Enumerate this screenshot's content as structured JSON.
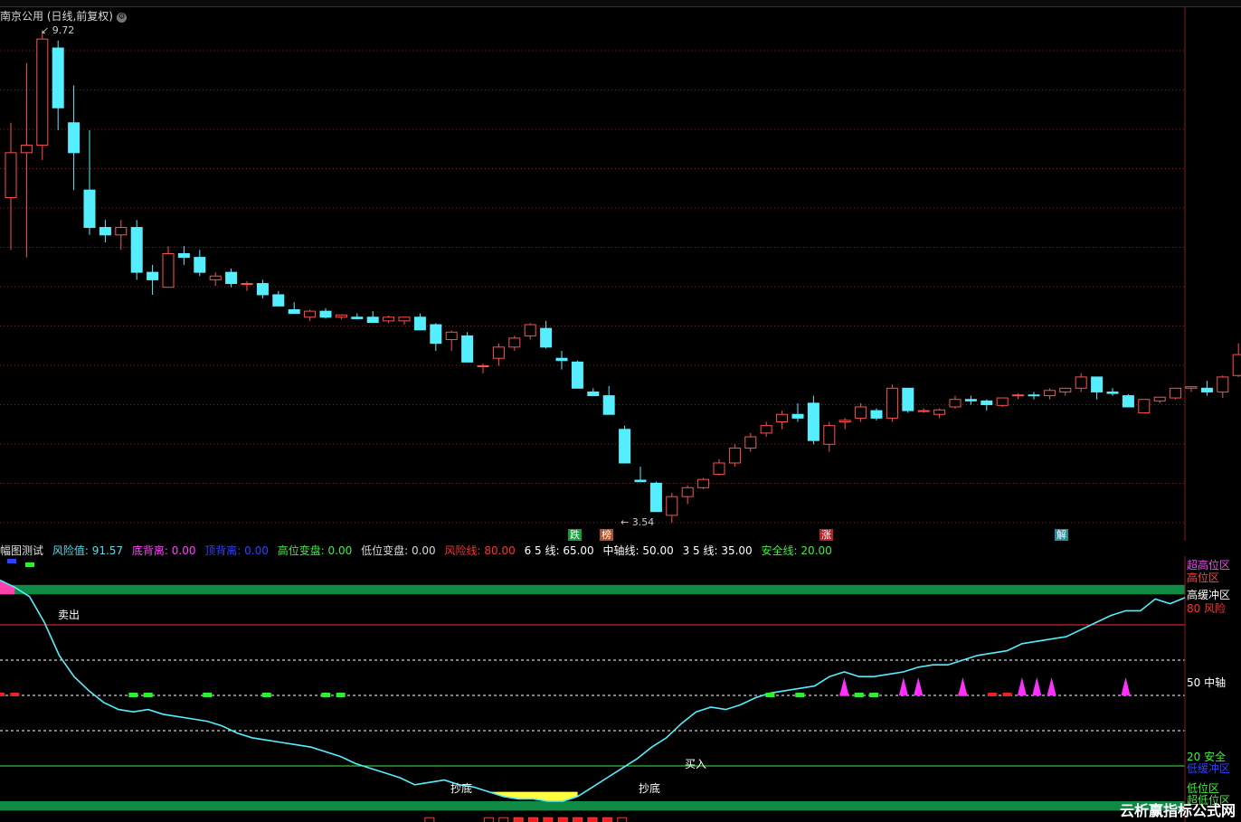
{
  "main": {
    "title": "南京公用 (日线,前复权)",
    "high_label": "9.72",
    "low_label": "3.54"
  },
  "markers": [
    {
      "text": "跌",
      "color": "#1a9a3a"
    },
    {
      "text": "榜",
      "color": "#b0502a"
    },
    {
      "text": "涨",
      "color": "#b8202a"
    },
    {
      "text": "解",
      "color": "#2a8a9a"
    }
  ],
  "indicator": {
    "name": "幅图测试",
    "items": [
      {
        "label": "风险值: 91.57",
        "color": "#55ddee"
      },
      {
        "label": "底背离: 0.00",
        "color": "#ff40ff"
      },
      {
        "label": "顶背离: 0.00",
        "color": "#3040ff"
      },
      {
        "label": "高位变盘: 0.00",
        "color": "#40ee40"
      },
      {
        "label": "低位变盘: 0.00",
        "color": "#d8d8d8"
      },
      {
        "label": "风险线: 80.00",
        "color": "#ff3030"
      },
      {
        "label": "6 5 线: 65.00",
        "color": "#ffffff"
      },
      {
        "label": "中轴线: 50.00",
        "color": "#ffffff"
      },
      {
        "label": "3 5 线: 35.00",
        "color": "#ffffff"
      },
      {
        "label": "安全线: 20.00",
        "color": "#40ee40"
      }
    ]
  },
  "zones": [
    {
      "text": "超高位区",
      "color": "#ff40ff"
    },
    {
      "text": "高位区",
      "color": "#ff4040"
    },
    {
      "text": "高缓冲区",
      "color": "#ffffff"
    },
    {
      "text": "80 风险",
      "color": "#ff3030"
    },
    {
      "text": "50 中轴",
      "color": "#ffffff"
    },
    {
      "text": "20 安全",
      "color": "#40ee40"
    },
    {
      "text": "低缓冲区",
      "color": "#3040ff"
    },
    {
      "text": "低位区",
      "color": "#40ee40"
    },
    {
      "text": "超低位区",
      "color": "#40ee40"
    }
  ],
  "annotations": {
    "sell": "卖出",
    "buy": "买入",
    "bottom1": "抄底",
    "bottom2": "抄底"
  },
  "watermark": "云析赢指标公式网",
  "colors": {
    "up": "#ff5050",
    "down": "#55eeff",
    "grid": "#8a1a1a"
  },
  "chart_data": [
    {
      "type": "candlestick",
      "title": "南京公用 (日线,前复权)",
      "high": 9.72,
      "low": 3.54,
      "ylim": [
        3.3,
        10.0
      ],
      "candles": [
        [
          7.6,
          8.6,
          6.9,
          8.2
        ],
        [
          8.2,
          9.4,
          6.8,
          8.3
        ],
        [
          8.3,
          9.8,
          8.1,
          9.72
        ],
        [
          9.6,
          9.7,
          8.5,
          8.8
        ],
        [
          8.6,
          9.1,
          7.7,
          8.2
        ],
        [
          7.7,
          8.5,
          7.1,
          7.2
        ],
        [
          7.2,
          7.3,
          7.0,
          7.1
        ],
        [
          7.1,
          7.3,
          6.9,
          7.2
        ],
        [
          7.2,
          7.3,
          6.5,
          6.6
        ],
        [
          6.6,
          6.7,
          6.3,
          6.5
        ],
        [
          6.4,
          6.95,
          6.4,
          6.85
        ],
        [
          6.85,
          6.95,
          6.7,
          6.8
        ],
        [
          6.8,
          6.9,
          6.55,
          6.6
        ],
        [
          6.5,
          6.6,
          6.42,
          6.55
        ],
        [
          6.6,
          6.65,
          6.4,
          6.45
        ],
        [
          6.45,
          6.48,
          6.35,
          6.45
        ],
        [
          6.45,
          6.5,
          6.25,
          6.3
        ],
        [
          6.3,
          6.35,
          6.15,
          6.15
        ],
        [
          6.1,
          6.2,
          6.05,
          6.05
        ],
        [
          6.0,
          6.1,
          5.95,
          6.08
        ],
        [
          6.08,
          6.12,
          5.98,
          6.0
        ],
        [
          6.0,
          6.03,
          5.97,
          6.03
        ],
        [
          6.0,
          6.05,
          5.97,
          5.98
        ],
        [
          6.0,
          6.08,
          5.95,
          5.93
        ],
        [
          5.95,
          6.02,
          5.92,
          6.0
        ],
        [
          5.95,
          6.0,
          5.9,
          6.0
        ],
        [
          6.0,
          6.05,
          5.85,
          5.83
        ],
        [
          5.9,
          5.92,
          5.55,
          5.65
        ],
        [
          5.7,
          5.82,
          5.55,
          5.8
        ],
        [
          5.75,
          5.8,
          5.42,
          5.4
        ],
        [
          5.35,
          5.38,
          5.25,
          5.35
        ],
        [
          5.45,
          5.65,
          5.35,
          5.6
        ],
        [
          5.6,
          5.75,
          5.55,
          5.72
        ],
        [
          5.75,
          5.92,
          5.7,
          5.9
        ],
        [
          5.85,
          5.95,
          5.58,
          5.6
        ],
        [
          5.45,
          5.55,
          5.3,
          5.42
        ],
        [
          5.4,
          5.42,
          5.05,
          5.05
        ],
        [
          5.0,
          5.05,
          4.95,
          4.95
        ],
        [
          4.95,
          5.08,
          4.75,
          4.7
        ],
        [
          4.5,
          4.55,
          4.05,
          4.05
        ],
        [
          3.82,
          4.0,
          3.8,
          3.8
        ],
        [
          3.78,
          3.8,
          3.4,
          3.4
        ],
        [
          3.35,
          3.65,
          3.25,
          3.6
        ],
        [
          3.6,
          3.75,
          3.5,
          3.72
        ],
        [
          3.72,
          3.85,
          3.7,
          3.83
        ],
        [
          3.9,
          4.1,
          3.88,
          4.05
        ],
        [
          4.05,
          4.3,
          4.0,
          4.25
        ],
        [
          4.25,
          4.45,
          4.2,
          4.4
        ],
        [
          4.45,
          4.6,
          4.4,
          4.55
        ],
        [
          4.6,
          4.75,
          4.5,
          4.7
        ],
        [
          4.7,
          4.85,
          4.6,
          4.65
        ],
        [
          4.85,
          4.95,
          4.3,
          4.35
        ],
        [
          4.3,
          4.6,
          4.2,
          4.55
        ],
        [
          4.6,
          4.65,
          4.5,
          4.62
        ],
        [
          4.65,
          4.85,
          4.6,
          4.8
        ],
        [
          4.75,
          4.78,
          4.62,
          4.65
        ],
        [
          4.65,
          5.1,
          4.6,
          5.05
        ],
        [
          5.05,
          5.05,
          4.72,
          4.75
        ],
        [
          4.75,
          4.78,
          4.72,
          4.75
        ],
        [
          4.7,
          4.78,
          4.65,
          4.76
        ],
        [
          4.8,
          4.95,
          4.78,
          4.9
        ],
        [
          4.9,
          4.95,
          4.83,
          4.88
        ],
        [
          4.88,
          4.9,
          4.75,
          4.83
        ],
        [
          4.82,
          4.92,
          4.8,
          4.92
        ],
        [
          4.95,
          4.98,
          4.9,
          4.96
        ],
        [
          4.96,
          5.0,
          4.9,
          4.95
        ],
        [
          4.95,
          5.05,
          4.9,
          5.02
        ],
        [
          5.0,
          5.05,
          4.95,
          5.05
        ],
        [
          5.05,
          5.25,
          5.0,
          5.2
        ],
        [
          5.2,
          5.2,
          4.9,
          5.0
        ],
        [
          5.0,
          5.05,
          4.95,
          4.98
        ],
        [
          4.95,
          4.97,
          4.8,
          4.8
        ],
        [
          4.72,
          4.9,
          4.72,
          4.9
        ],
        [
          4.88,
          4.93,
          4.85,
          4.93
        ],
        [
          4.92,
          5.05,
          4.9,
          5.05
        ],
        [
          5.05,
          5.08,
          5.0,
          5.07
        ],
        [
          5.05,
          5.15,
          4.95,
          5.0
        ],
        [
          5.0,
          5.22,
          4.92,
          5.2
        ],
        [
          5.22,
          5.65,
          5.2,
          5.5
        ],
        [
          5.5,
          5.82,
          5.45,
          5.9
        ]
      ]
    },
    {
      "type": "line",
      "title": "幅图测试",
      "ylim": [
        -5,
        105
      ],
      "series": [
        {
          "name": "风险值",
          "values": [
            99,
            96,
            92,
            81,
            67,
            58,
            52,
            47,
            44,
            43,
            44,
            42,
            41,
            40,
            39,
            37,
            34,
            32,
            31,
            30,
            29,
            28,
            26,
            24,
            21,
            19,
            17,
            15,
            12,
            13,
            14,
            12,
            11,
            9,
            7,
            6,
            6,
            5,
            5,
            7,
            11,
            15,
            19,
            23,
            28,
            32,
            38,
            43,
            45,
            44,
            46,
            49,
            51,
            52,
            53,
            54,
            58,
            60,
            58,
            58,
            59,
            60,
            62,
            63,
            63,
            65,
            67,
            68,
            69,
            72,
            73,
            74,
            75,
            78,
            81,
            84,
            86,
            86,
            91,
            89,
            91.57
          ]
        }
      ]
    }
  ]
}
